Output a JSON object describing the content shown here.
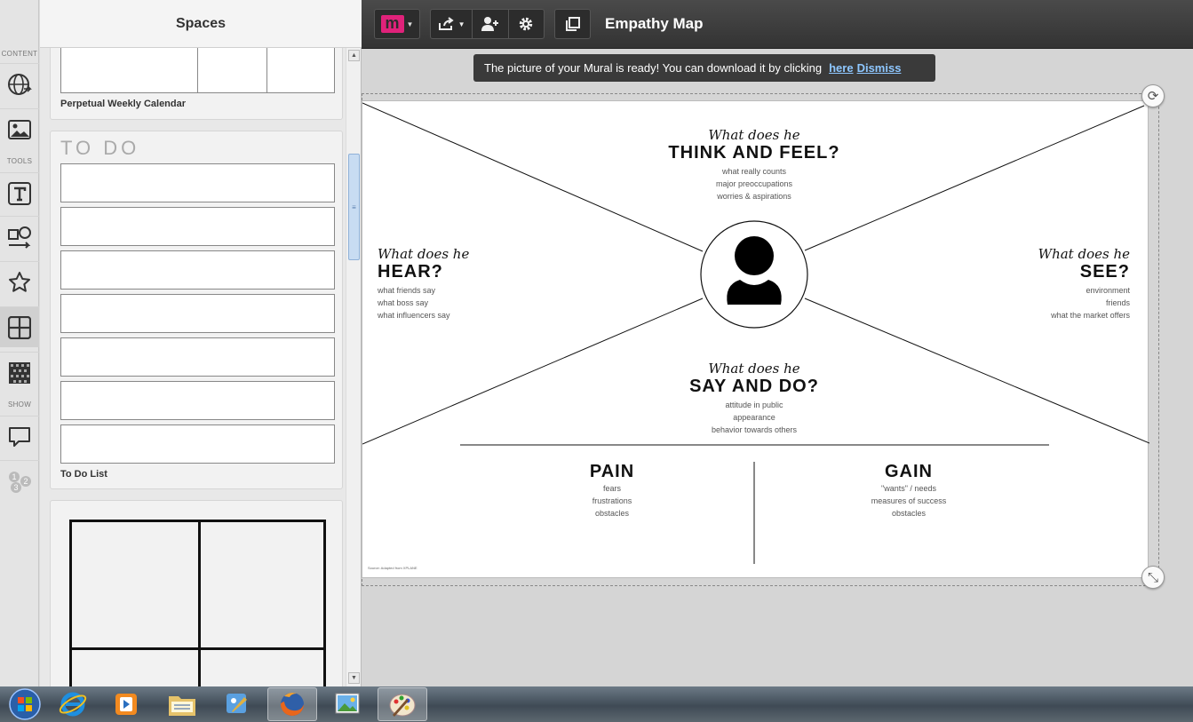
{
  "rail": {
    "labels": {
      "content": "CONTENT",
      "tools": "TOOLS",
      "show": "SHOW"
    },
    "icons": [
      "globe-icon",
      "image-icon",
      "text-icon",
      "shape-connector-icon",
      "star-icon",
      "grid-icon",
      "pattern-icon",
      "comment-icon",
      "numbers-icon"
    ]
  },
  "panel": {
    "title": "Spaces",
    "calendar_caption": "Perpetual Weekly Calendar",
    "todo_heading": "TO DO",
    "todo_caption": "To Do List"
  },
  "toolbar": {
    "logo": "m",
    "board_title": "Empathy Map"
  },
  "notice": {
    "text": "The picture of your Mural is ready! You can download it by clicking",
    "link_here": "here",
    "link_dismiss": "Dismiss"
  },
  "empathy_map": {
    "think": {
      "script": "What does he",
      "head": "THINK AND FEEL?",
      "lines": [
        "what really counts",
        "major preoccupations",
        "worries & aspirations"
      ]
    },
    "hear": {
      "script": "What does he",
      "head": "HEAR?",
      "lines": [
        "what friends say",
        "what boss say",
        "what influencers say"
      ]
    },
    "see": {
      "script": "What does he",
      "head": "SEE?",
      "lines": [
        "environment",
        "friends",
        "what the market offers"
      ]
    },
    "say": {
      "script": "What does he",
      "head": "SAY AND DO?",
      "lines": [
        "attitude in public",
        "appearance",
        "behavior towards others"
      ]
    },
    "pain": {
      "head": "PAIN",
      "lines": [
        "fears",
        "frustrations",
        "obstacles"
      ]
    },
    "gain": {
      "head": "GAIN",
      "lines": [
        "\"wants\" / needs",
        "measures of success",
        "obstacles"
      ]
    },
    "source": "Source: Adapted from XPLANE"
  },
  "colors": {
    "accent": "#e0227a",
    "toolbar": "#3a3a3a"
  },
  "taskbar": {
    "items": [
      "windows-start-icon",
      "internet-explorer-icon",
      "media-player-icon",
      "file-explorer-icon",
      "paint-brush-app-icon",
      "firefox-icon",
      "photo-viewer-icon",
      "paint-icon"
    ]
  }
}
